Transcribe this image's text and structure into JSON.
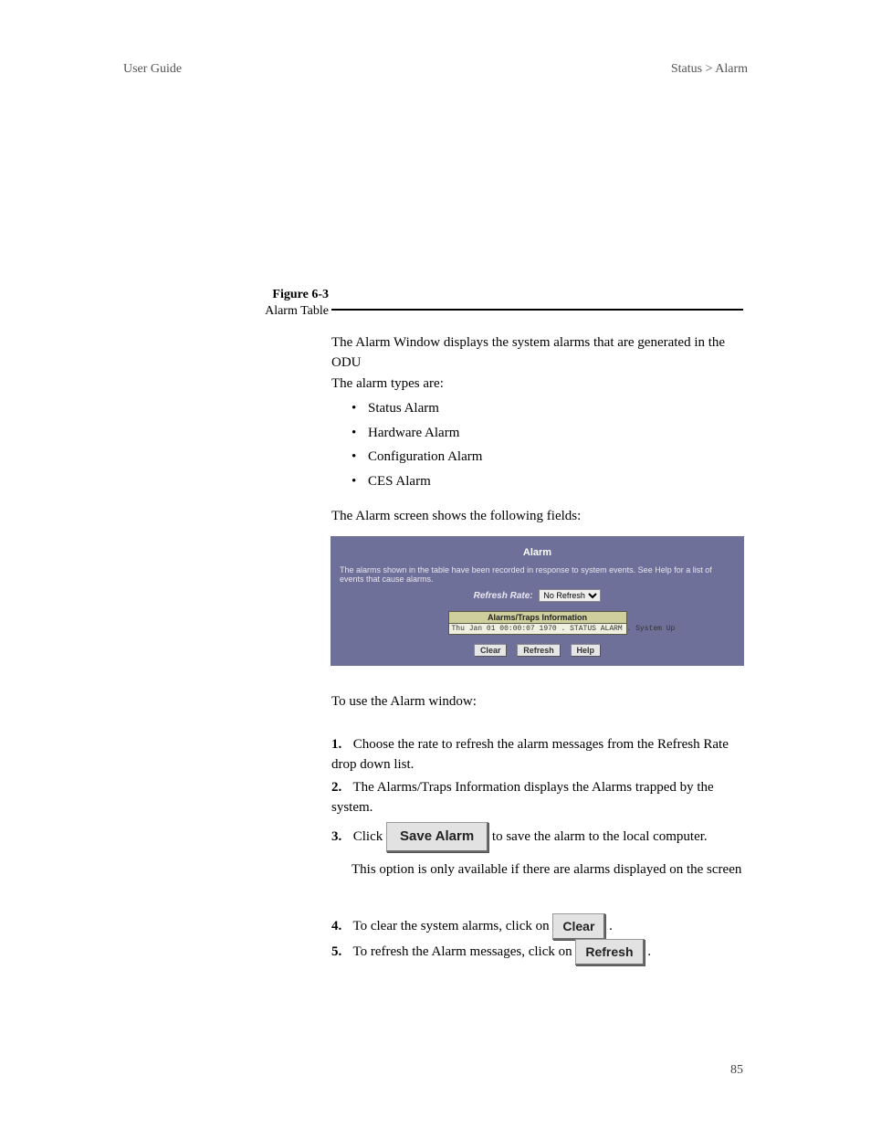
{
  "header": {
    "left": "User Guide",
    "right": "Status > Alarm"
  },
  "figure": {
    "number": "Figure 6-3",
    "title": "Alarm Table"
  },
  "paragraphs": {
    "p1": "The Alarm Window displays the system alarms that are generated in the ODU",
    "p2": "The alarm types are:",
    "p3": "The Alarm screen shows the following fields:",
    "p4": "To use the Alarm window:"
  },
  "alarm_types": [
    "Status Alarm",
    "Hardware Alarm",
    "Configuration Alarm",
    "CES Alarm"
  ],
  "alarm_panel": {
    "title": "Alarm",
    "description": "The alarms shown in the table have been recorded in response to system events. See Help for a list of events that cause alarms.",
    "refresh_label": "Refresh Rate:",
    "refresh_value": "No Refresh",
    "table_header": "Alarms/Traps Information",
    "table_row": "Thu Jan 01 00:00:07 1970 . STATUS ALARM . System Up",
    "buttons": {
      "clear": "Clear",
      "refresh": "Refresh",
      "help": "Help"
    }
  },
  "steps": {
    "s1_num": "1.",
    "s1": "Choose the rate to refresh the alarm messages from the Refresh Rate drop down list.",
    "s2_num": "2.",
    "s2": "The Alarms/Traps Information displays the Alarms trapped by the system.",
    "s3_num": "3.",
    "s3_prefix": "Click ",
    "s3_suffix": " to save the alarm to the local computer.",
    "s3b": "This option is only available if there are alarms displayed on the screen",
    "s4_num": "4.",
    "s4_prefix": "To clear the system alarms, click on ",
    "s4_suffix": ".",
    "s5_num": "5.",
    "s5_prefix": "To refresh the Alarm messages, click on ",
    "s5_suffix": "."
  },
  "buttons": {
    "save_alarm": "Save Alarm",
    "clear": "Clear",
    "refresh": "Refresh"
  },
  "pagenum": "85"
}
